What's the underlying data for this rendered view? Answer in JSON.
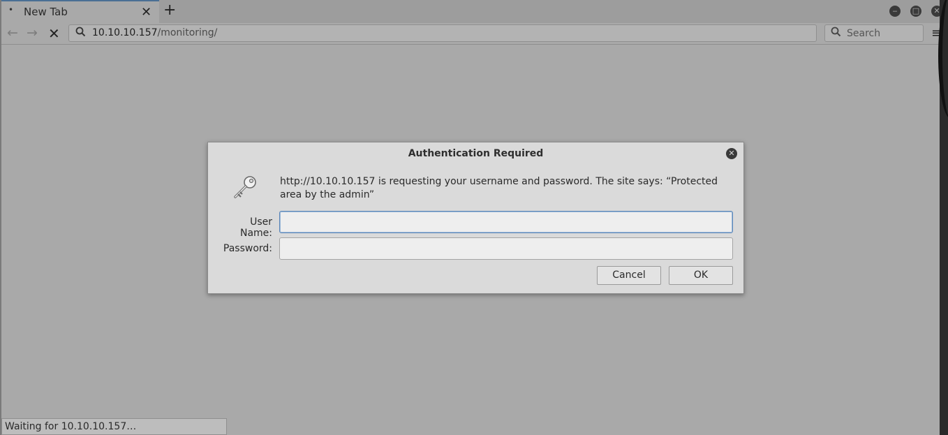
{
  "tab": {
    "title": "New Tab",
    "dot": "•",
    "close": "✕",
    "new_tab": "+"
  },
  "window_controls": {
    "minimize": "‒",
    "maximize": "□",
    "close": "✕"
  },
  "navbar": {
    "back": "←",
    "forward": "→",
    "stop": "✕",
    "url_host": "10.10.10.157",
    "url_path": "/monitoring/",
    "search_placeholder": "Search",
    "menu": "≡"
  },
  "dialog": {
    "title": "Authentication Required",
    "close": "✕",
    "message": "http://10.10.10.157 is requesting your username and password. The site says: “Protected area by the admin”",
    "username_label": "User Name:",
    "username_value": "",
    "password_label": "Password:",
    "password_value": "",
    "cancel_label": "Cancel",
    "ok_label": "OK",
    "icon": "key-icon"
  },
  "status": {
    "text": "Waiting for 10.10.10.157…"
  },
  "colors": {
    "page_background": "#a9a9a9",
    "dialog_background": "#dadada",
    "focus_border": "#5a86b8"
  }
}
